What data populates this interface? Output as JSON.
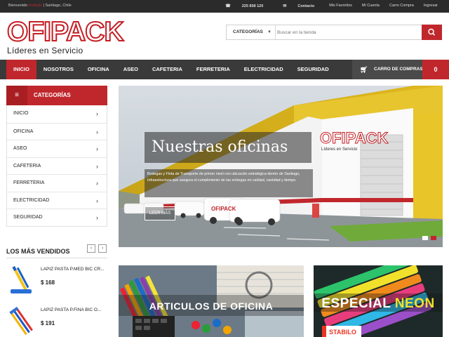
{
  "topbar": {
    "welcome_prefix": "Bienvenido",
    "welcome_user": "Invitado",
    "welcome_city": "| Santiago, Chile",
    "phone": "225 858 120",
    "contact": "Contacto",
    "favorites": "Mis Favoritos",
    "account": "Mi Cuenta",
    "cart": "Carro Compra",
    "login": "Ingresar"
  },
  "logo": {
    "word": "OFIPACK",
    "tagline": "Líderes en Servicio"
  },
  "search": {
    "category_label": "CATEGORÍAS",
    "placeholder": "Buscar en la tienda"
  },
  "nav": {
    "items": [
      "INICIO",
      "NOSOTROS",
      "OFICINA",
      "ASEO",
      "CAFETERIA",
      "FERRETERIA",
      "ELECTRICIDAD",
      "SEGURIDAD"
    ],
    "cart_label": "CARRO DE COMPRAS",
    "cart_count": "0"
  },
  "categories": {
    "title": "CATEGORÍAS",
    "items": [
      "INICIO",
      "OFICINA",
      "ASEO",
      "CAFETERIA",
      "FERRETERIA",
      "ELECTRICIDAD",
      "SEGURIDAD"
    ]
  },
  "hero": {
    "title": "Nuestras oficinas",
    "text": "Bodegas y Flota de Transporte de primer nivel con ubicación estratégica dentro de Santiago, Infraestructura que asegura el cumplimiento de las entregas en calidad, cantidad y tiempo.",
    "button": "LEER MÁS",
    "building_sign": "OFIPACK",
    "building_sub": "Líderes en Servicio"
  },
  "bestsellers": {
    "title": "LOS MÁS VENDIDOS",
    "products": [
      {
        "name": "LAPIZ PASTA P.MED BIC CR...",
        "price": "$ 168"
      },
      {
        "name": "LAPIZ PASTA P.FINA BIC O...",
        "price": "$ 191"
      }
    ]
  },
  "banners": {
    "office": "ARTICULOS DE OFICINA",
    "neon_prefix": "ESPECIAL ",
    "neon_highlight": "NEON",
    "brand": "STABILO"
  },
  "colors": {
    "brand_red": "#c0272d",
    "nav_dark": "#3a3a3a",
    "topbar": "#2b2b2b"
  }
}
